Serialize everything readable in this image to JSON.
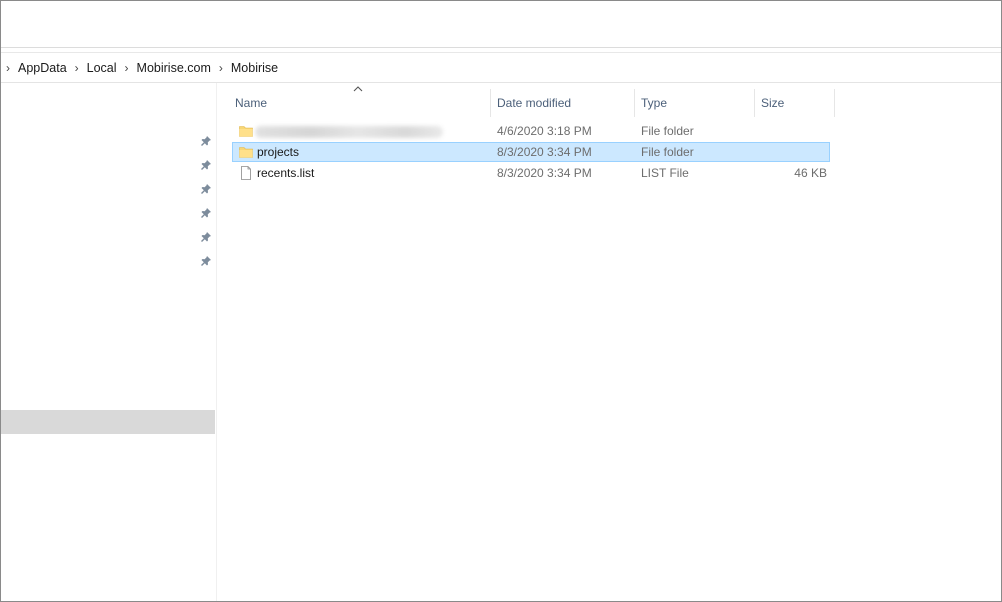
{
  "breadcrumb": {
    "items": [
      {
        "label": "AppData"
      },
      {
        "label": "Local"
      },
      {
        "label": "Mobirise.com"
      },
      {
        "label": "Mobirise"
      }
    ]
  },
  "columns": {
    "name": "Name",
    "date_modified": "Date modified",
    "type": "Type",
    "size": "Size",
    "sorted_by": "Name"
  },
  "files": [
    {
      "name": "",
      "name_redacted": true,
      "date_modified": "4/6/2020 3:18 PM",
      "type": "File folder",
      "size": "",
      "icon": "folder-icon",
      "selected": false
    },
    {
      "name": "projects",
      "date_modified": "8/3/2020 3:34 PM",
      "type": "File folder",
      "size": "",
      "icon": "folder-icon",
      "selected": true
    },
    {
      "name": "recents.list",
      "date_modified": "8/3/2020 3:34 PM",
      "type": "LIST File",
      "size": "46 KB",
      "icon": "document-icon",
      "selected": false
    }
  ],
  "navpane": {
    "pinned_count": 6,
    "selected_item_visible": true
  },
  "colors": {
    "selection_bg": "#cce8ff",
    "selection_border": "#99d1ff",
    "header_text": "#4c607a",
    "folder_yellow": "#f8d775",
    "nav_selected_bg": "#d9d9d9"
  }
}
